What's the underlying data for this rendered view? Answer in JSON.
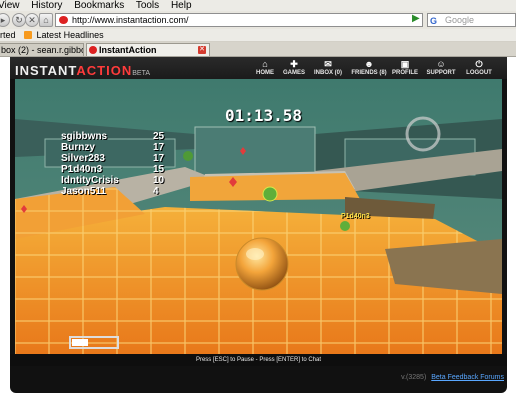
{
  "browser": {
    "menu": [
      "View",
      "History",
      "Bookmarks",
      "Tools",
      "Help"
    ],
    "url": "http://www.instantaction.com/",
    "search_placeholder": "Google",
    "bookmarks_label": "Latest Headlines",
    "bookmarks_prefix": "rted",
    "tabs": [
      {
        "label": "box (2) - sean.r.gibbons@..."
      },
      {
        "label": "InstantAction"
      }
    ]
  },
  "site": {
    "logo_main": "INSTANT",
    "logo_accent": "ACTION",
    "logo_beta": "BETA",
    "nav": [
      {
        "label": "HOME",
        "icon": "home-icon"
      },
      {
        "label": "GAMES",
        "icon": "gamepad-icon"
      },
      {
        "label": "INBOX (0)",
        "icon": "mail-icon"
      },
      {
        "label": "FRIENDS (8)",
        "icon": "friends-icon"
      },
      {
        "label": "PROFILE",
        "icon": "profile-icon"
      },
      {
        "label": "SUPPORT",
        "icon": "support-icon"
      },
      {
        "label": "LOGOUT",
        "icon": "power-icon"
      }
    ],
    "hint": "Press [ESC] to Pause - Press [ENTER] to Chat",
    "version": "v.(3285)",
    "feedback_link": "Beta Feedback Forums"
  },
  "game": {
    "timer": "01:13.58",
    "scoreboard": [
      {
        "name": "sgibbwns",
        "score": "25"
      },
      {
        "name": "Burnzy",
        "score": "17"
      },
      {
        "name": "Silver283",
        "score": "17"
      },
      {
        "name": "P1d40n3",
        "score": "15"
      },
      {
        "name": "IdntityCrisis",
        "score": "10"
      },
      {
        "name": "Jason511",
        "score": "4"
      }
    ],
    "tag_player_1": "",
    "tag_player_2": "P1d40n3"
  }
}
